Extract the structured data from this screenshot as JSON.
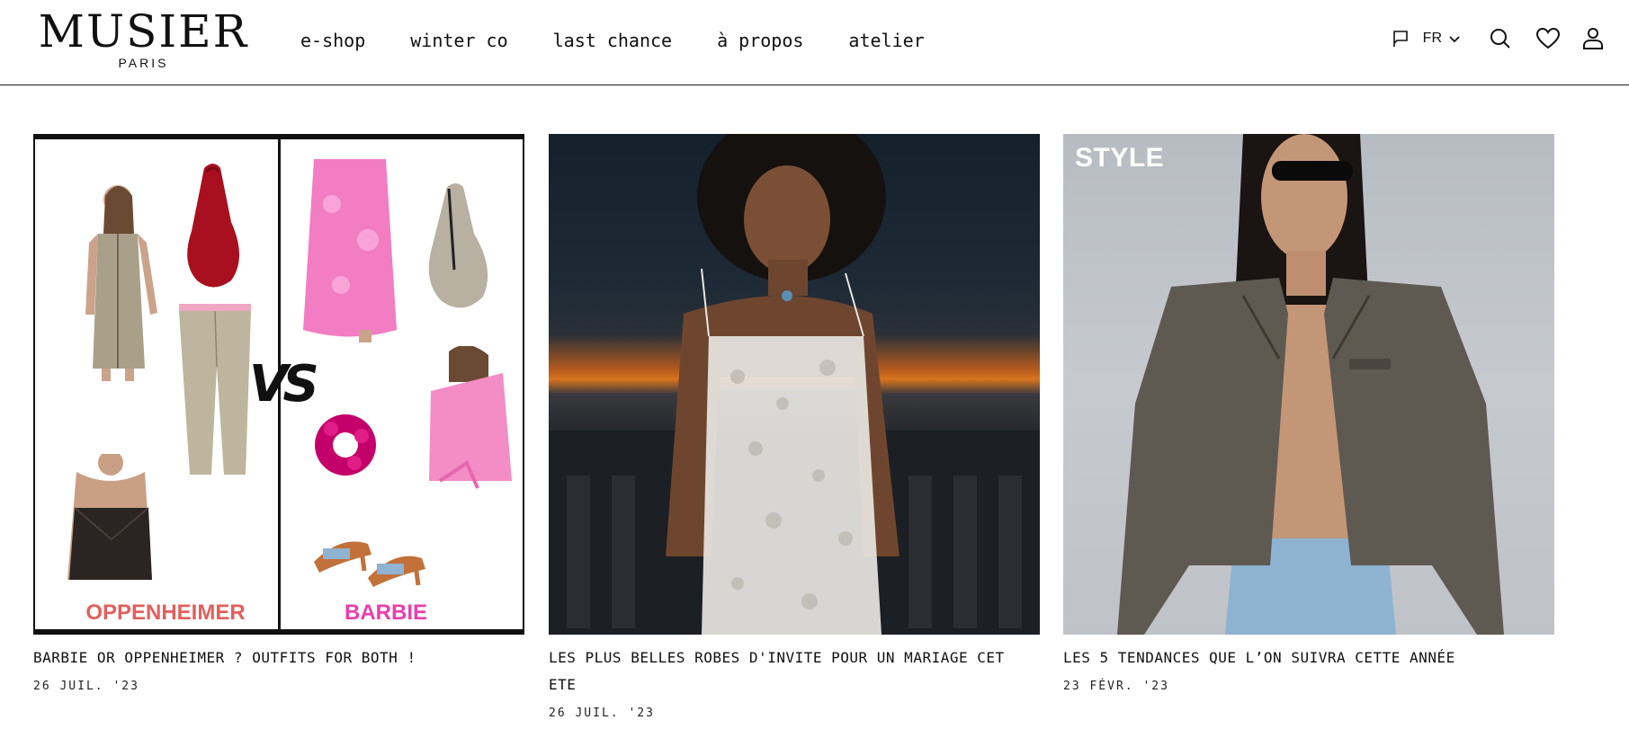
{
  "header": {
    "logo": {
      "name": "MUSIER",
      "sub": "PARIS"
    },
    "nav": [
      {
        "label": "e-shop"
      },
      {
        "label": "winter co"
      },
      {
        "label": "last chance"
      },
      {
        "label": "à propos"
      },
      {
        "label": "atelier"
      }
    ],
    "tools": {
      "language": "FR",
      "icons": [
        "flag-icon",
        "chevron-down-icon",
        "search-icon",
        "heart-icon",
        "user-icon"
      ]
    }
  },
  "articles": [
    {
      "image_texts": {
        "left_caption": "OPPENHEIMER",
        "right_caption": "BARBIE",
        "center": "VS"
      },
      "title": "BARBIE OR OPPENHEIMER ? OUTFITS FOR BOTH !",
      "date": "26 JUIL. '23"
    },
    {
      "title": "LES PLUS BELLES ROBES D'INVITE POUR UN MARIAGE CET ETE",
      "date": "26 JUIL. '23"
    },
    {
      "image_texts": {
        "label": "STYLE"
      },
      "title": "LES 5 TENDANCES QUE L’ON SUIVRA CETTE ANNÉE",
      "date": "23 FÉVR. '23"
    }
  ],
  "colors": {
    "oppenheimer": "#e2605c",
    "barbie": "#e83fae",
    "text": "#111111"
  }
}
